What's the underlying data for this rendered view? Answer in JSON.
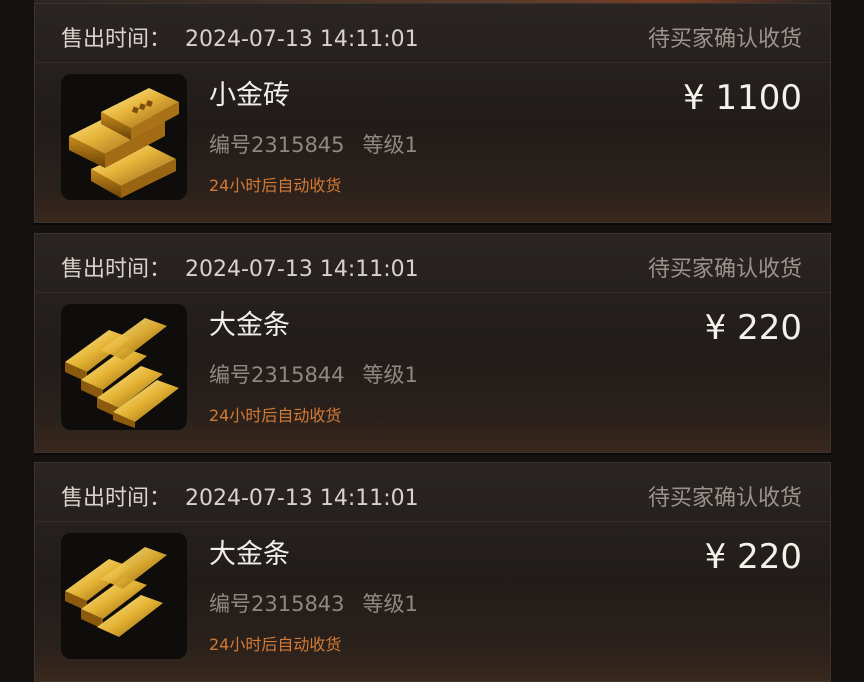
{
  "orders": [
    {
      "sale_label": "售出时间：",
      "sale_time": "2024-07-13 14:11:01",
      "status": "待买家确认收货",
      "item_name": "小金砖",
      "item_id": "编号2315845",
      "level": "等级1",
      "notice": "24小时后自动收货",
      "price": "¥ 1100",
      "icon": "gold-brick-icon"
    },
    {
      "sale_label": "售出时间：",
      "sale_time": "2024-07-13 14:11:01",
      "status": "待买家确认收货",
      "item_name": "大金条",
      "item_id": "编号2315844",
      "level": "等级1",
      "notice": "24小时后自动收货",
      "price": "¥ 220",
      "icon": "gold-bar-icon"
    },
    {
      "sale_label": "售出时间：",
      "sale_time": "2024-07-13 14:11:01",
      "status": "待买家确认收货",
      "item_name": "大金条",
      "item_id": "编号2315843",
      "level": "等级1",
      "notice": "24小时后自动收货",
      "price": "¥ 220",
      "icon": "gold-bar-icon"
    }
  ],
  "colors": {
    "background": "#141110",
    "card": "#231e1c",
    "notice": "#d47a35",
    "status": "#9a938d",
    "gold": "#e0b23a"
  }
}
